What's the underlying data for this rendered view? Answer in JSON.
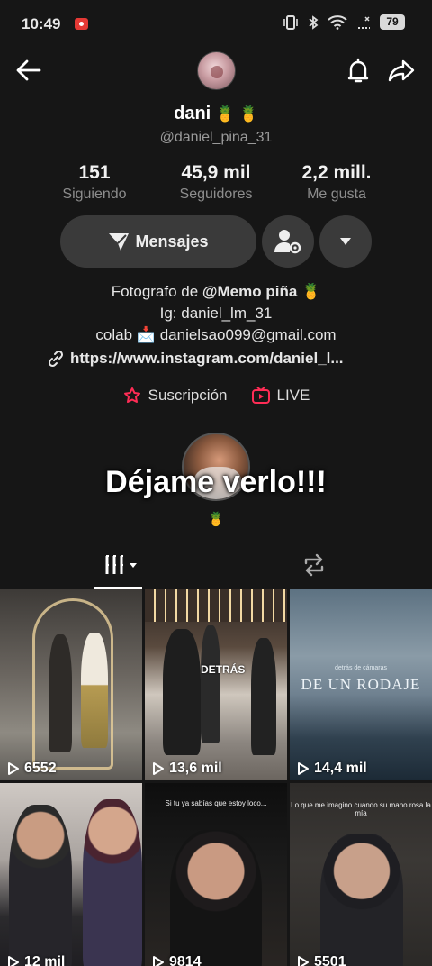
{
  "status_bar": {
    "time": "10:49",
    "battery": "79"
  },
  "profile": {
    "name": "dani",
    "name_emoji": "🍍 🍍",
    "handle": "@daniel_pina_31",
    "stats": [
      {
        "value": "151",
        "label": "Siguiendo"
      },
      {
        "value": "45,9 mil",
        "label": "Seguidores"
      },
      {
        "value": "2,2 mill.",
        "label": "Me gusta"
      }
    ],
    "message_button": "Mensajes",
    "bio": {
      "line1_prefix": "Fotografo de ",
      "line1_mention": "@Memo piña",
      "line1_emoji": "🍍",
      "line2": "Ig: daniel_lm_31",
      "line3_prefix": "colab",
      "line3_emoji": "📩",
      "line3_email": "danielsao099@gmail.com"
    },
    "link": "https://www.instagram.com/daniel_l...",
    "subscription_label": "Suscripción",
    "live_label": "LIVE"
  },
  "overlay_text": "Déjame verlo!!!",
  "overlay_emoji": "🍍",
  "videos": [
    {
      "views": "6552"
    },
    {
      "views": "13,6 mil",
      "overlay": "DETRÁS"
    },
    {
      "views": "14,4 mil",
      "caption_small": "detrás de cámaras",
      "caption_big": "DE UN RODAJE"
    },
    {
      "views": "12 mil"
    },
    {
      "views": "9814",
      "caption": "Si tu ya sabías que estoy loco..."
    },
    {
      "views": "5501",
      "caption": "Lo que me imagino cuando su mano rosa la mía"
    }
  ],
  "colors": {
    "background": "#161616",
    "button_bg": "#3a3a3a",
    "accent_pink": "#fe2c55"
  },
  "icons": [
    "back-arrow-icon",
    "bell-icon",
    "share-icon",
    "send-icon",
    "add-friend-icon",
    "dropdown-icon",
    "link-icon",
    "subscription-icon",
    "live-icon",
    "videos-grid-icon",
    "repost-icon",
    "play-icon"
  ]
}
